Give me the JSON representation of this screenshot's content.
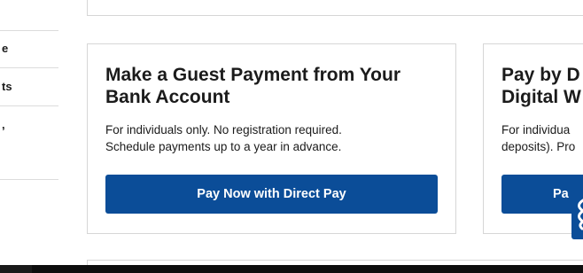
{
  "sidebar": {
    "items": [
      {
        "label": "e"
      },
      {
        "label": "ts"
      },
      {
        "label": ","
      }
    ]
  },
  "cards": {
    "guest": {
      "title": "Make a Guest Payment from Your Bank Account",
      "description_line1": "For individuals only. No registration required.",
      "description_line2": "Schedule payments up to a year in advance.",
      "button_label": "Pay Now with Direct Pay"
    },
    "digital": {
      "title_line1": "Pay by D",
      "title_line2": "Digital W",
      "description_line1": "For individua",
      "description_line2": "deposits). Pro",
      "button_label": "Pa"
    }
  },
  "colors": {
    "primary_button": "#0b4d98",
    "border": "#d6d6d6",
    "text": "#1b1b1b"
  },
  "icons": {
    "feedback": "feedback-icon"
  }
}
